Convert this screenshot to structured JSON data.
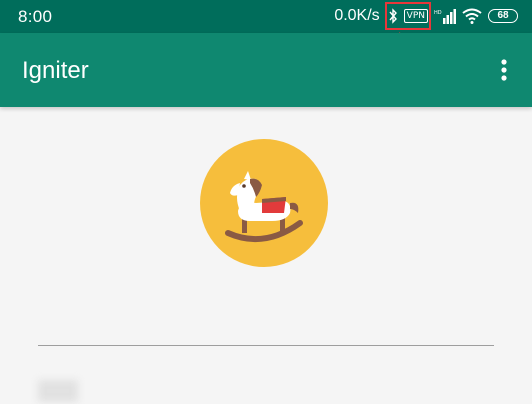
{
  "status_bar": {
    "time": "8:00",
    "net_speed": "0.0K/s",
    "vpn_label": "VPN",
    "battery_level": "68",
    "icons": [
      "bluetooth-icon",
      "vpn-icon",
      "signal-icon",
      "wifi-icon",
      "battery-icon"
    ]
  },
  "app_bar": {
    "title": "Igniter",
    "menu_icon": "more-vert-icon"
  },
  "logo": {
    "icon": "rocking-horse-icon",
    "circle_color": "#f6be3c"
  },
  "form": {
    "server_field_value": "",
    "second_field_value": ""
  },
  "colors": {
    "status_bar": "#006d5b",
    "app_bar": "#0f8870",
    "annotation": "#e8373a"
  }
}
